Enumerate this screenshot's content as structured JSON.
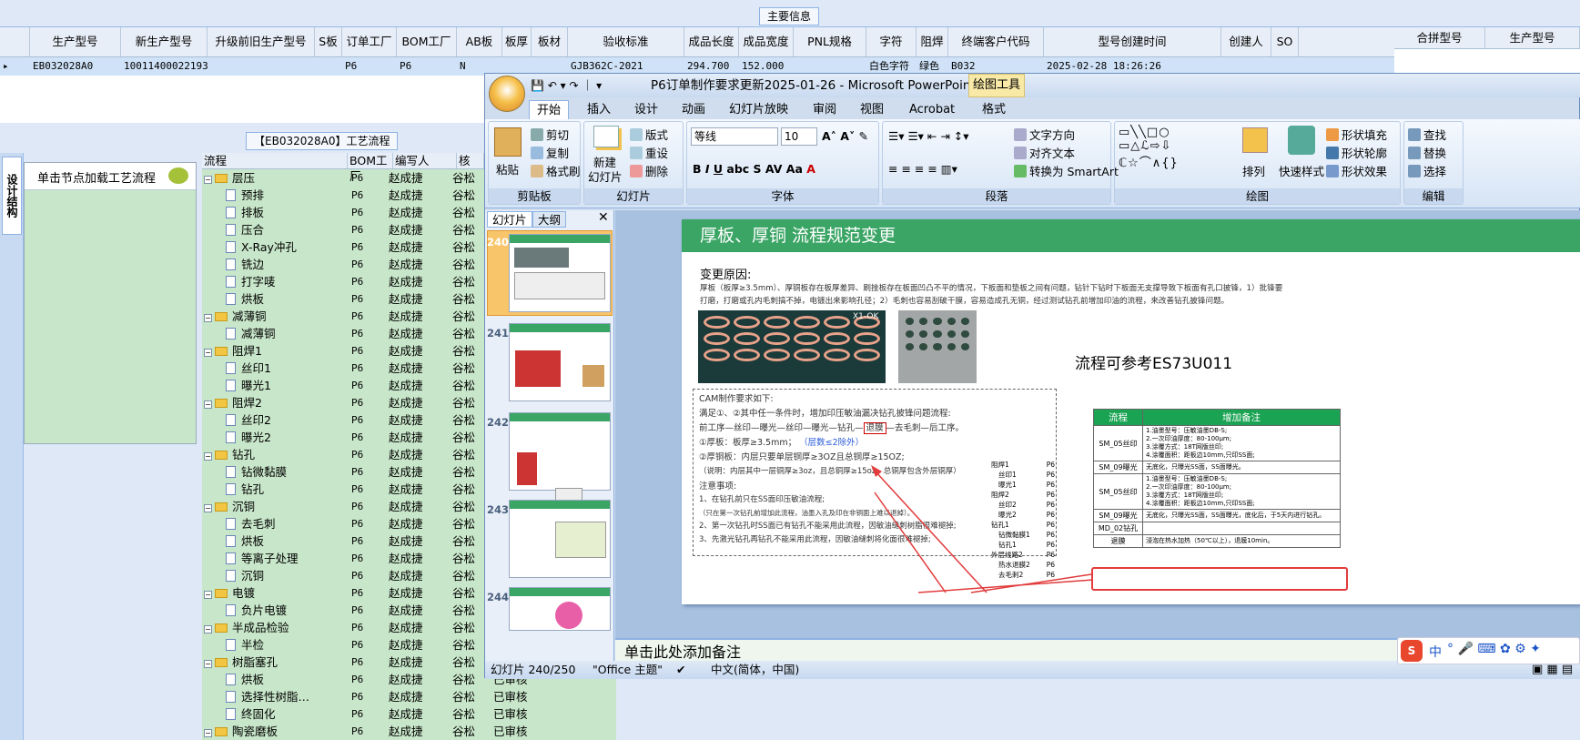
{
  "main_tab": "主要信息",
  "grid": {
    "columns": [
      "生产型号",
      "新生产型号",
      "升级前旧生产型号",
      "S板",
      "订单工厂",
      "BOM工厂",
      "AB板",
      "板厚",
      "板材",
      "验收标准",
      "成品长度",
      "成品宽度",
      "PNL规格",
      "字符",
      "阻焊",
      "终端客户代码",
      "型号创建时间",
      "创建人",
      "SO"
    ],
    "row": [
      "EB032028A0",
      "10011400022193",
      "",
      "",
      "P6",
      "P6",
      "N",
      "",
      "",
      "GJB362C-2021",
      "294.700",
      "152.000",
      "",
      "白色字符",
      "绿色",
      "B032",
      "2025-02-28 18:26:26",
      "",
      ""
    ]
  },
  "right_grid": {
    "columns": [
      "合拼型号",
      "生产型号"
    ]
  },
  "process_tab": "【EB032028A0】工艺流程",
  "left_vtab": "设计结构",
  "node_panel_label": "单击节点加载工艺流程",
  "tree": {
    "headers": [
      "流程",
      "BOM工厂",
      "编写人",
      "核"
    ],
    "rows": [
      {
        "level": 0,
        "name": "层压",
        "fac": "P6",
        "writer": "赵成捷",
        "rev": "谷松",
        "st": ""
      },
      {
        "level": 1,
        "name": "预排",
        "fac": "P6",
        "writer": "赵成捷",
        "rev": "谷松",
        "st": ""
      },
      {
        "level": 1,
        "name": "排板",
        "fac": "P6",
        "writer": "赵成捷",
        "rev": "谷松",
        "st": ""
      },
      {
        "level": 1,
        "name": "压合",
        "fac": "P6",
        "writer": "赵成捷",
        "rev": "谷松",
        "st": ""
      },
      {
        "level": 1,
        "name": "X-Ray冲孔",
        "fac": "P6",
        "writer": "赵成捷",
        "rev": "谷松",
        "st": ""
      },
      {
        "level": 1,
        "name": "铣边",
        "fac": "P6",
        "writer": "赵成捷",
        "rev": "谷松",
        "st": ""
      },
      {
        "level": 1,
        "name": "打字唛",
        "fac": "P6",
        "writer": "赵成捷",
        "rev": "谷松",
        "st": ""
      },
      {
        "level": 1,
        "name": "烘板",
        "fac": "P6",
        "writer": "赵成捷",
        "rev": "谷松",
        "st": ""
      },
      {
        "level": 0,
        "name": "减薄铜",
        "fac": "P6",
        "writer": "赵成捷",
        "rev": "谷松",
        "st": ""
      },
      {
        "level": 1,
        "name": "减薄铜",
        "fac": "P6",
        "writer": "赵成捷",
        "rev": "谷松",
        "st": ""
      },
      {
        "level": 0,
        "name": "阻焊1",
        "fac": "P6",
        "writer": "赵成捷",
        "rev": "谷松",
        "st": ""
      },
      {
        "level": 1,
        "name": "丝印1",
        "fac": "P6",
        "writer": "赵成捷",
        "rev": "谷松",
        "st": ""
      },
      {
        "level": 1,
        "name": "曝光1",
        "fac": "P6",
        "writer": "赵成捷",
        "rev": "谷松",
        "st": ""
      },
      {
        "level": 0,
        "name": "阻焊2",
        "fac": "P6",
        "writer": "赵成捷",
        "rev": "谷松",
        "st": ""
      },
      {
        "level": 1,
        "name": "丝印2",
        "fac": "P6",
        "writer": "赵成捷",
        "rev": "谷松",
        "st": ""
      },
      {
        "level": 1,
        "name": "曝光2",
        "fac": "P6",
        "writer": "赵成捷",
        "rev": "谷松",
        "st": ""
      },
      {
        "level": 0,
        "name": "钻孔",
        "fac": "P6",
        "writer": "赵成捷",
        "rev": "谷松",
        "st": ""
      },
      {
        "level": 1,
        "name": "钻微黏膜",
        "fac": "P6",
        "writer": "赵成捷",
        "rev": "谷松",
        "st": ""
      },
      {
        "level": 1,
        "name": "钻孔",
        "fac": "P6",
        "writer": "赵成捷",
        "rev": "谷松",
        "st": ""
      },
      {
        "level": 0,
        "name": "沉铜",
        "fac": "P6",
        "writer": "赵成捷",
        "rev": "谷松",
        "st": ""
      },
      {
        "level": 1,
        "name": "去毛刺",
        "fac": "P6",
        "writer": "赵成捷",
        "rev": "谷松",
        "st": ""
      },
      {
        "level": 1,
        "name": "烘板",
        "fac": "P6",
        "writer": "赵成捷",
        "rev": "谷松",
        "st": ""
      },
      {
        "level": 1,
        "name": "等离子处理",
        "fac": "P6",
        "writer": "赵成捷",
        "rev": "谷松",
        "st": ""
      },
      {
        "level": 1,
        "name": "沉铜",
        "fac": "P6",
        "writer": "赵成捷",
        "rev": "谷松",
        "st": ""
      },
      {
        "level": 0,
        "name": "电镀",
        "fac": "P6",
        "writer": "赵成捷",
        "rev": "谷松",
        "st": ""
      },
      {
        "level": 1,
        "name": "负片电镀",
        "fac": "P6",
        "writer": "赵成捷",
        "rev": "谷松",
        "st": ""
      },
      {
        "level": 0,
        "name": "半成品检验",
        "fac": "P6",
        "writer": "赵成捷",
        "rev": "谷松",
        "st": ""
      },
      {
        "level": 1,
        "name": "半检",
        "fac": "P6",
        "writer": "赵成捷",
        "rev": "谷松",
        "st": ""
      },
      {
        "level": 0,
        "name": "树脂塞孔",
        "fac": "P6",
        "writer": "赵成捷",
        "rev": "谷松",
        "st": "已审核"
      },
      {
        "level": 1,
        "name": "烘板",
        "fac": "P6",
        "writer": "赵成捷",
        "rev": "谷松",
        "st": "已审核"
      },
      {
        "level": 1,
        "name": "选择性树脂…",
        "fac": "P6",
        "writer": "赵成捷",
        "rev": "谷松",
        "st": "已审核"
      },
      {
        "level": 1,
        "name": "终固化",
        "fac": "P6",
        "writer": "赵成捷",
        "rev": "谷松",
        "st": "已审核"
      },
      {
        "level": 0,
        "name": "陶瓷磨板",
        "fac": "P6",
        "writer": "赵成捷",
        "rev": "谷松",
        "st": "已审核"
      }
    ]
  },
  "ppt": {
    "title": "P6订单制作要求更新2025-01-26 - Microsoft PowerPoint",
    "context_tab": "绘图工具",
    "tabs": [
      "开始",
      "插入",
      "设计",
      "动画",
      "幻灯片放映",
      "审阅",
      "视图",
      "Acrobat",
      "格式"
    ],
    "clipboard": {
      "paste": "粘贴",
      "cut": "剪切",
      "copy": "复制",
      "format": "格式刷",
      "label": "剪贴板"
    },
    "slides_group": {
      "new": "新建",
      "new2": "幻灯片",
      "layout": "版式",
      "reset": "重设",
      "delete": "删除",
      "label": "幻灯片"
    },
    "font": {
      "name": "等线",
      "size": "10",
      "label": "字体"
    },
    "paragraph": {
      "direction": "文字方向",
      "align": "对齐文本",
      "smartart": "转换为 SmartArt",
      "label": "段落"
    },
    "drawing": {
      "arrange": "排列",
      "quick": "快速样式",
      "fill": "形状填充",
      "outline": "形状轮廓",
      "effect": "形状效果",
      "label": "绘图"
    },
    "editing": {
      "find": "查找",
      "replace": "替换",
      "select": "选择",
      "label": "编辑"
    },
    "pane_tabs": [
      "幻灯片",
      "大纲"
    ],
    "thumb_numbers": [
      "240",
      "241",
      "242",
      "243",
      "244"
    ],
    "slide": {
      "title": "厚板、厚铜 流程规范变更",
      "reason_title": "变更原因:",
      "reason_text1": "厚板（板厚≥3.5mm）、厚铜板存在板厚差异、刷挫板存在板面凹凸不平的情况，下板面和垫板之间有问题，钻针下钻时下板面无支撑导致下板面有孔口披锋，1）批锋要",
      "reason_text2": "打磨，打磨或孔内毛刺搞不掉，电镀出来影响孔径；2）毛刺也容易刮破干膜，容易造成孔无铜，经过测试钻孔前增加印油的流程，来改善钻孔披锋问题。",
      "img_label": "X1-OK",
      "ref": "流程可参考ES73U011",
      "cam_title": "CAM制作要求如下:",
      "cam1": "满足①、②其中任一条件时，增加印压敏油漏决钻孔披锋问题流程:",
      "cam2a": "前工序—丝印—曝光—丝印—曝光—钻孔—",
      "cam2b": "退膜",
      "cam2c": "—去毛刺—后工序。",
      "cam3": "①厚板：板厚≥3.5mm；",
      "cam3b": "（层数≤2除外）",
      "cam4": "②厚铜板：内层只要单层铜厚≥3OZ且总铜厚≥15OZ;",
      "cam5": "（说明：内层其中一层铜厚≥3oz，且总铜厚≥15oz，总铜厚包含外层铜厚）",
      "note_title": "注意事项:",
      "note1": "1、在钻孔前只在SS面印压敏油流程;",
      "note1b": "（只在第一次钻孔前增加此流程，油墨入孔及印在非铜面上难以退掉）。",
      "note2": "2、第一次钻孔时SS面已有钻孔不能采用此流程，因敏油缝刺树脂很难褪掉;",
      "note3": "3、先激光钻孔再钻孔不能采用此流程，因敏油缝刺将化面很难褪掉;",
      "mini_tree": [
        [
          "阻焊1",
          "P6"
        ],
        [
          "丝印1",
          "P6"
        ],
        [
          "曝光1",
          "P6"
        ],
        [
          "阻焊2",
          "P6"
        ],
        [
          "丝印2",
          "P6"
        ],
        [
          "曝光2",
          "P6"
        ],
        [
          "钻孔1",
          "P6"
        ],
        [
          "钻微黏膜1",
          "P6"
        ],
        [
          "钻孔1",
          "P6"
        ],
        [
          "外层线路2",
          "P6"
        ],
        [
          "热水退膜2",
          "P6"
        ],
        [
          "去毛刺2",
          "P6"
        ]
      ],
      "table": {
        "headers": [
          "流程",
          "增加备注"
        ],
        "rows": [
          [
            "SM_05丝印",
            "1.油墨型号：压敏油墨DB-S;\n2.一次印油厚度：80-100μm;\n3.涂覆方式：18T网版丝印;\n4.涂覆面积：距板边10mm,只印SS面;"
          ],
          [
            "SM_09曝光",
            "无底化，只曝光SS面，SS面曝光。"
          ],
          [
            "SM_05丝印",
            "1.油墨型号：压敏油墨DB-S;\n2.一次印油厚度：80-100μm;\n3.涂覆方式：18T网版丝印;\n4.涂覆面积：距板边10mm,只印SS面;"
          ],
          [
            "SM_09曝光",
            "无底化，只曝光SS面，SS面曝光，底化后，于5天内进行钻孔。"
          ],
          [
            "MD_02钻孔",
            ""
          ],
          [
            "退膜",
            "浸泡在热水加热（50℃以上），退膜10min。"
          ]
        ]
      }
    },
    "notes_placeholder": "单击此处添加备注",
    "status": {
      "slide": "幻灯片 240/250",
      "theme": "\"Office 主题\"",
      "lang": "中文(简体，中国)"
    }
  },
  "ime": {
    "logo": "S",
    "lang": "中"
  }
}
